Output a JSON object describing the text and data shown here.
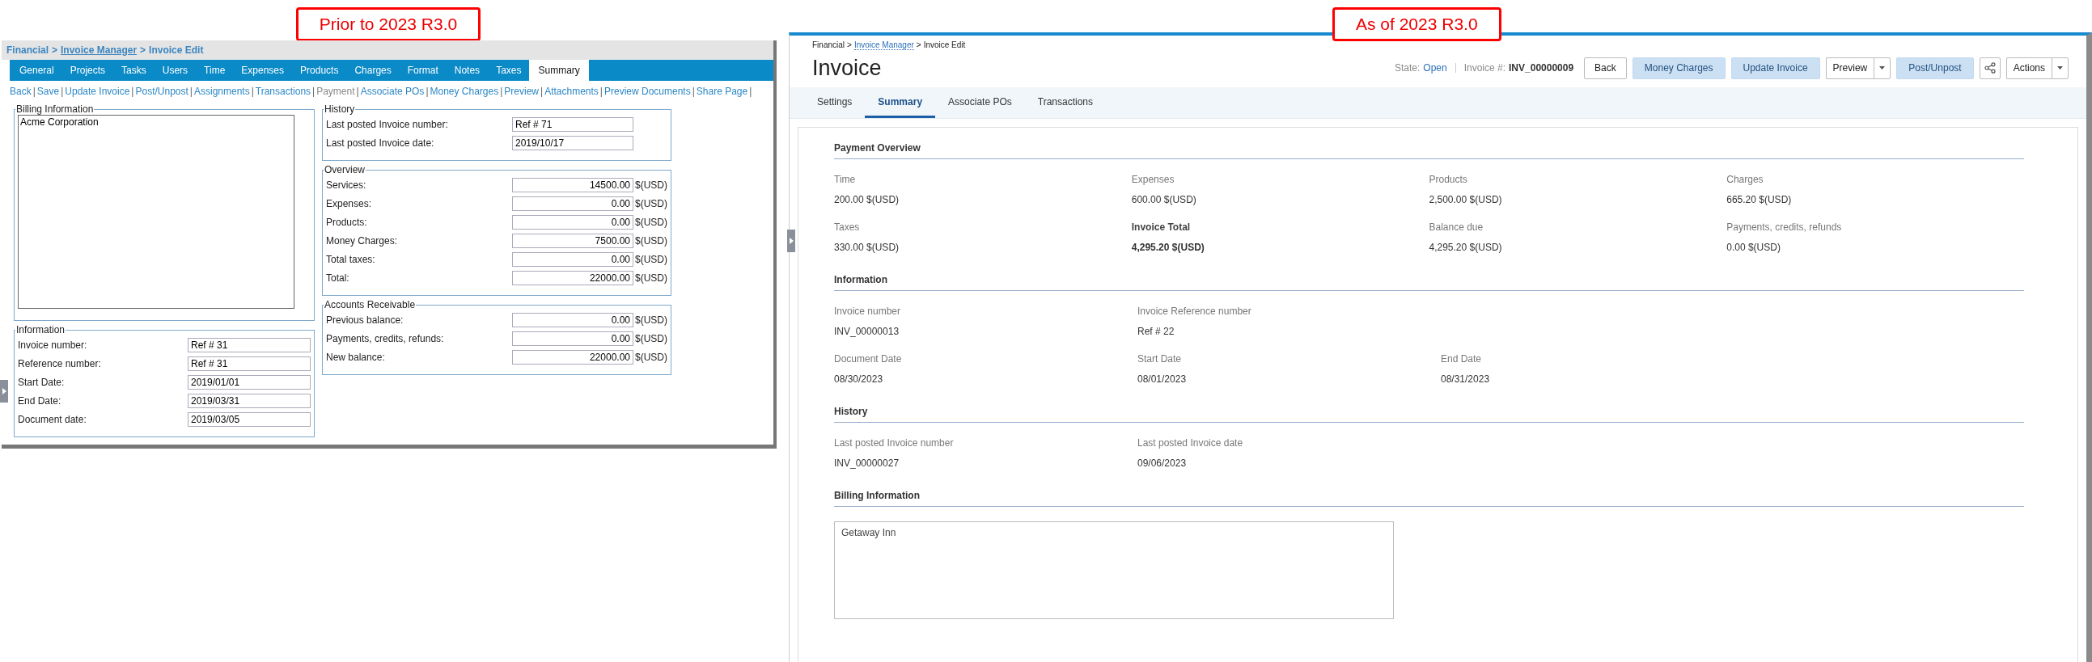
{
  "legacy": {
    "label": "Prior to 2023 R3.0",
    "breadcrumb": {
      "separator": ">",
      "items": [
        {
          "label": "Financial",
          "link": false
        },
        {
          "label": "Invoice Manager",
          "link": true
        },
        {
          "label": "Invoice Edit",
          "link": false
        }
      ]
    },
    "tabs": [
      {
        "label": "General",
        "selected": false
      },
      {
        "label": "Projects",
        "selected": false
      },
      {
        "label": "Tasks",
        "selected": false
      },
      {
        "label": "Users",
        "selected": false
      },
      {
        "label": "Time",
        "selected": false
      },
      {
        "label": "Expenses",
        "selected": false
      },
      {
        "label": "Products",
        "selected": false
      },
      {
        "label": "Charges",
        "selected": false
      },
      {
        "label": "Format",
        "selected": false
      },
      {
        "label": "Notes",
        "selected": false
      },
      {
        "label": "Taxes",
        "selected": false
      },
      {
        "label": "Summary",
        "selected": true
      }
    ],
    "link_separator": "|",
    "links": [
      {
        "label": "Back",
        "disabled": false
      },
      {
        "label": "Save",
        "disabled": false
      },
      {
        "label": "Update Invoice",
        "disabled": false
      },
      {
        "label": "Post/Unpost",
        "disabled": false
      },
      {
        "label": "Assignments",
        "disabled": false
      },
      {
        "label": "Transactions",
        "disabled": false
      },
      {
        "label": "Payment",
        "disabled": true
      },
      {
        "label": "Associate POs",
        "disabled": false
      },
      {
        "label": "Money Charges",
        "disabled": false
      },
      {
        "label": "Preview",
        "disabled": false
      },
      {
        "label": "Attachments",
        "disabled": false
      },
      {
        "label": "Preview Documents",
        "disabled": false
      },
      {
        "label": "Share Page",
        "disabled": false
      }
    ],
    "left_column": [
      {
        "title": "Billing Information",
        "kind": "textarea",
        "value": "Acme Corporation"
      },
      {
        "title": "Information",
        "kind": "fields",
        "rows": [
          {
            "label": "Invoice number:",
            "value": "Ref # 31"
          },
          {
            "label": "Reference number:",
            "value": "Ref # 31"
          },
          {
            "label": "Start Date:",
            "value": "2019/01/01"
          },
          {
            "label": "End Date:",
            "value": "2019/03/31"
          },
          {
            "label": "Document date:",
            "value": "2019/03/05"
          }
        ]
      }
    ],
    "right_column": [
      {
        "title": "History",
        "kind": "fields",
        "rows": [
          {
            "label": "Last posted Invoice number:",
            "value": "Ref # 71"
          },
          {
            "label": "Last posted Invoice date:",
            "value": "2019/10/17"
          }
        ]
      },
      {
        "title": "Overview",
        "kind": "fields",
        "rows": [
          {
            "label": "Services:",
            "value": "14500.00",
            "unit": "$(USD)"
          },
          {
            "label": "Expenses:",
            "value": "0.00",
            "unit": "$(USD)"
          },
          {
            "label": "Products:",
            "value": "0.00",
            "unit": "$(USD)"
          },
          {
            "label": "Money Charges:",
            "value": "7500.00",
            "unit": "$(USD)"
          },
          {
            "label": "Total taxes:",
            "value": "0.00",
            "unit": "$(USD)"
          },
          {
            "label": "Total:",
            "value": "22000.00",
            "unit": "$(USD)"
          }
        ]
      },
      {
        "title": "Accounts Receivable",
        "kind": "fields",
        "rows": [
          {
            "label": "Previous balance:",
            "value": "0.00",
            "unit": "$(USD)"
          },
          {
            "label": "Payments, credits, refunds:",
            "value": "0.00",
            "unit": "$(USD)"
          },
          {
            "label": "New balance:",
            "value": "22000.00",
            "unit": "$(USD)"
          }
        ]
      }
    ]
  },
  "current": {
    "label": "As of 2023 R3.0",
    "breadcrumb": {
      "separator": ">",
      "items": [
        {
          "label": "Financial",
          "link": false
        },
        {
          "label": "Invoice Manager",
          "link": true
        },
        {
          "label": "Invoice Edit",
          "link": false
        }
      ]
    },
    "title": "Invoice",
    "state": {
      "label": "State:",
      "value": "Open"
    },
    "invoice_number": {
      "label": "Invoice #:",
      "value": "INV_00000009"
    },
    "buttons": [
      {
        "kind": "plain",
        "label": "Back"
      },
      {
        "kind": "primary",
        "label": "Money Charges"
      },
      {
        "kind": "primary",
        "label": "Update Invoice"
      },
      {
        "kind": "split",
        "label": "Preview"
      },
      {
        "kind": "primary",
        "label": "Post/Unpost"
      },
      {
        "kind": "share"
      },
      {
        "kind": "split",
        "label": "Actions"
      }
    ],
    "tabs": [
      {
        "label": "Settings",
        "selected": false
      },
      {
        "label": "Summary",
        "selected": true
      },
      {
        "label": "Associate POs",
        "selected": false
      },
      {
        "label": "Transactions",
        "selected": false
      }
    ],
    "sections": [
      {
        "title": "Payment Overview",
        "kind": "fields",
        "rows": [
          [
            {
              "label": "Time",
              "value": "200.00 $(USD)",
              "bold": false
            },
            {
              "label": "Expenses",
              "value": "600.00 $(USD)",
              "bold": false
            },
            {
              "label": "Products",
              "value": "2,500.00 $(USD)",
              "bold": false
            },
            {
              "label": "Charges",
              "value": "665.20 $(USD)",
              "bold": false
            }
          ],
          [
            {
              "label": "Taxes",
              "value": "330.00 $(USD)",
              "bold": false
            },
            {
              "label": "Invoice Total",
              "value": "4,295.20 $(USD)",
              "bold": true
            },
            {
              "label": "Balance due",
              "value": "4,295.20 $(USD)",
              "bold": false
            },
            {
              "label": "Payments, credits, refunds",
              "value": "0.00 $(USD)",
              "bold": false
            }
          ]
        ]
      },
      {
        "title": "Information",
        "kind": "fields",
        "rows": [
          [
            {
              "label": "Invoice number",
              "value": "INV_00000013",
              "bold": false
            },
            {
              "label": "Invoice Reference number",
              "value": "Ref # 22",
              "bold": false
            }
          ],
          [
            {
              "label": "Document Date",
              "value": "08/30/2023",
              "bold": false
            },
            {
              "label": "Start Date",
              "value": "08/01/2023",
              "bold": false
            },
            {
              "label": "End Date",
              "value": "08/31/2023",
              "bold": false
            }
          ]
        ]
      },
      {
        "title": "History",
        "kind": "fields",
        "rows": [
          [
            {
              "label": "Last posted Invoice number",
              "value": "INV_00000027",
              "bold": false
            },
            {
              "label": "Last posted Invoice date",
              "value": "09/06/2023",
              "bold": false
            }
          ]
        ]
      },
      {
        "title": "Billing Information",
        "kind": "textarea",
        "value": "Getaway Inn"
      }
    ]
  }
}
